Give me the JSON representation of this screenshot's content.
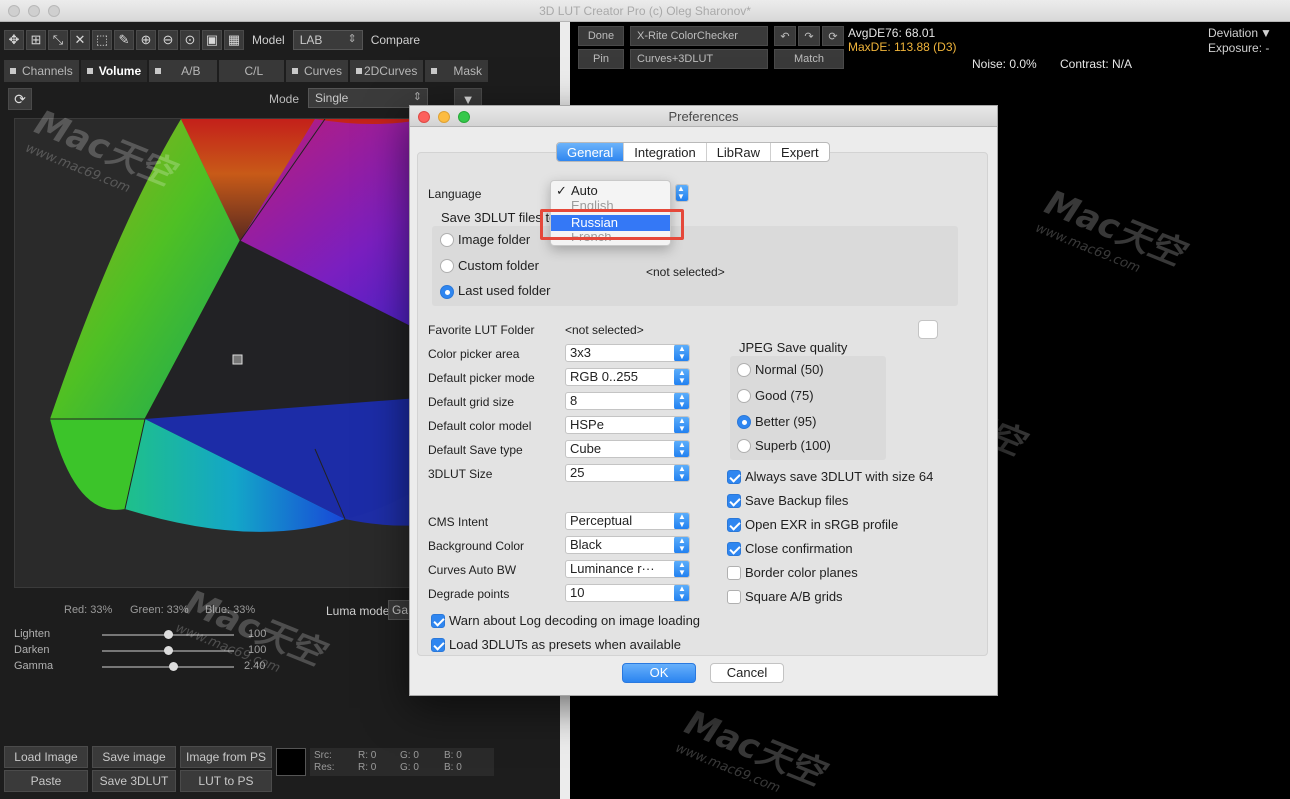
{
  "window": {
    "title": "3D LUT Creator Pro (c) Oleg Sharonov*"
  },
  "toolbar": {
    "model_label": "Model",
    "model_value": "LAB",
    "compare_label": "Compare",
    "icons": [
      "move-icon",
      "grid-icon",
      "shrink-icon",
      "expand-icon",
      "select-rect-icon",
      "eyedropper-icon",
      "zoom-in-icon",
      "zoom-out-icon",
      "zoom-fit-icon",
      "frame-icon",
      "grid-view-icon"
    ]
  },
  "tabs": [
    "Channels",
    "Volume",
    "A/B",
    "C/L",
    "Curves",
    "2DCurves",
    "Mask"
  ],
  "mode": {
    "label": "Mode",
    "value": "Single"
  },
  "stats": {
    "red": "Red: 33%",
    "green": "Green: 33%",
    "blue": "Blue: 33%",
    "luma_label": "Luma mode",
    "luma_value": "Ga"
  },
  "sliders": [
    {
      "label": "Lighten",
      "value": "100",
      "level": 0.5
    },
    {
      "label": "Darken",
      "value": "100",
      "level": 0.5
    },
    {
      "label": "Gamma",
      "value": "2.40",
      "level": 0.54
    }
  ],
  "buttons": {
    "load_image": "Load Image",
    "save_image": "Save image",
    "image_from_ps": "Image from PS",
    "paste": "Paste",
    "save_3dlut": "Save 3DLUT",
    "lut_to_ps": "LUT to PS"
  },
  "srcres": {
    "src": "Src:",
    "res": "Res:",
    "r1": "R:  0",
    "g1": "G:  0",
    "b1": "B:  0",
    "r2": "R:  0",
    "g2": "G:  0",
    "b2": "B:  0"
  },
  "right": {
    "done": "Done",
    "pin": "Pin",
    "checker": "X-Rite ColorChecker",
    "curves": "Curves+3DLUT",
    "match": "Match",
    "avg": "AvgDE76: 68.01",
    "max": "MaxDE: 113.88 (D3)",
    "deviation": "Deviation",
    "exposure": "Exposure: -",
    "noise": "Noise: 0.0%",
    "contrast": "Contrast: N/A"
  },
  "dialog": {
    "title": "Preferences",
    "tabs": [
      "General",
      "Integration",
      "LibRaw",
      "Expert"
    ],
    "language_label": "Language",
    "language_options": [
      "Auto",
      "English",
      "Russian",
      "French"
    ],
    "save_label": "Save 3DLUT files to",
    "folders": [
      "Image folder",
      "Custom folder",
      "Last used folder"
    ],
    "not_selected": "<not selected>",
    "favorite_label": "Favorite LUT Folder",
    "favorite_value": "<not selected>",
    "settings": [
      {
        "label": "Color picker area",
        "value": "3x3"
      },
      {
        "label": "Default picker mode",
        "value": "RGB 0..255"
      },
      {
        "label": "Default grid size",
        "value": "8"
      },
      {
        "label": "Default color model",
        "value": "HSPe"
      },
      {
        "label": "Default Save type",
        "value": "Cube"
      },
      {
        "label": "3DLUT Size",
        "value": "25"
      },
      {
        "label": "CMS Intent",
        "value": "Perceptual"
      },
      {
        "label": "Background Color",
        "value": "Black"
      },
      {
        "label": "Curves Auto BW",
        "value": "Luminance r···"
      },
      {
        "label": "Degrade points",
        "value": "10"
      }
    ],
    "jpeg_title": "JPEG Save quality",
    "jpeg_options": [
      "Normal (50)",
      "Good (75)",
      "Better (95)",
      "Superb (100)"
    ],
    "checkboxes": [
      {
        "label": "Always save 3DLUT with size 64",
        "checked": true
      },
      {
        "label": "Save Backup files",
        "checked": true
      },
      {
        "label": "Open EXR in sRGB profile",
        "checked": true
      },
      {
        "label": "Close confirmation",
        "checked": true
      },
      {
        "label": "Border color planes",
        "checked": false
      },
      {
        "label": "Square A/B grids",
        "checked": false
      }
    ],
    "warn_log": "Warn about Log decoding on image loading",
    "load_presets": "Load 3DLUTs as presets when available",
    "ok": "OK",
    "cancel": "Cancel"
  }
}
